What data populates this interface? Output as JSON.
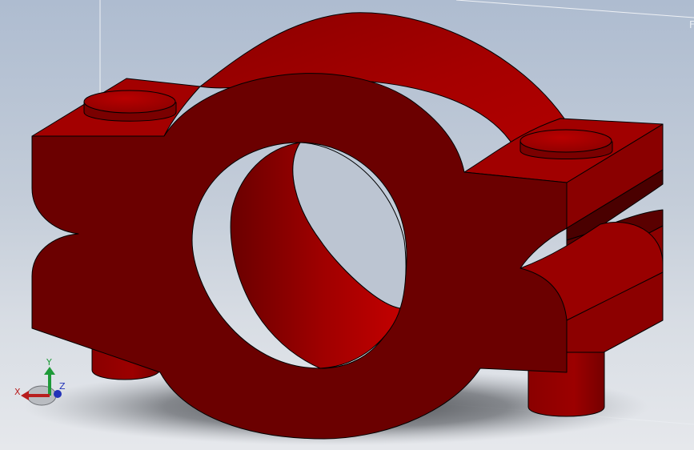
{
  "viewport": {
    "corner_text": "F"
  },
  "triad": {
    "x_label": "X",
    "y_label": "Y",
    "z_label": "Z",
    "x_color": "#b81e1e",
    "y_color": "#1e9a38",
    "z_color": "#2333b8"
  },
  "model": {
    "color_front": "#6b0000",
    "color_lit": "#a30000",
    "color_mid": "#8b0000",
    "color_dark": "#520000"
  }
}
